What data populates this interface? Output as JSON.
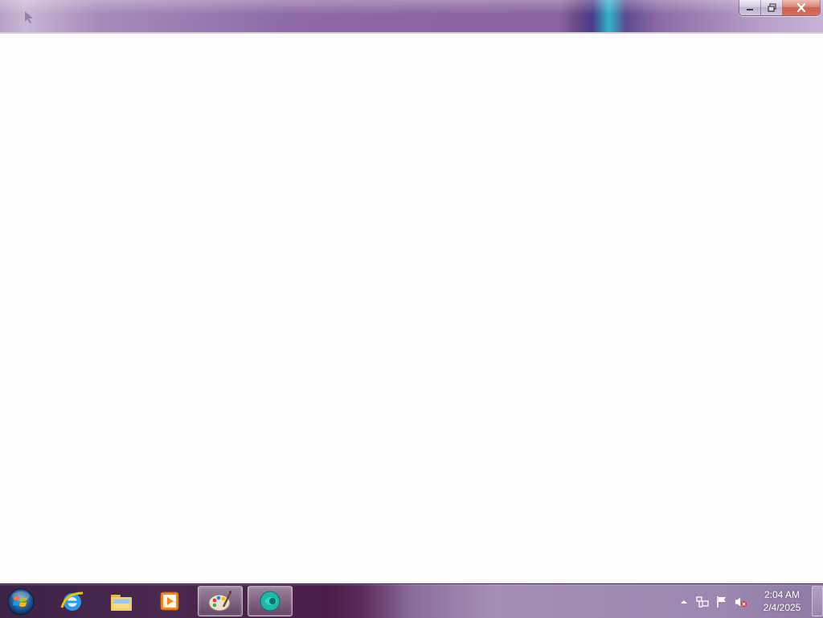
{
  "window": {
    "title": "",
    "controls": {
      "minimize_icon": "minimize-icon",
      "restore_icon": "restore-icon",
      "close_icon": "close-icon"
    }
  },
  "taskbar": {
    "pinned": [
      {
        "name": "internet-explorer",
        "icon": "internet-explorer-icon",
        "active": false
      },
      {
        "name": "windows-explorer",
        "icon": "folder-icon",
        "active": false
      },
      {
        "name": "media-player",
        "icon": "media-player-icon",
        "active": false
      },
      {
        "name": "paint",
        "icon": "paint-palette-icon",
        "active": true
      },
      {
        "name": "app",
        "icon": "teal-app-icon",
        "active": true
      }
    ],
    "tray": {
      "icons": [
        "show-hidden-icons-arrow",
        "network-icon",
        "action-center-flag-icon",
        "volume-muted-icon"
      ],
      "time": "2:04 AM",
      "date": "2/4/2025"
    }
  },
  "colors": {
    "titlebar_accent": "#8b64a3",
    "close_button": "#c94b36",
    "taskbar": "#9b88b0"
  }
}
